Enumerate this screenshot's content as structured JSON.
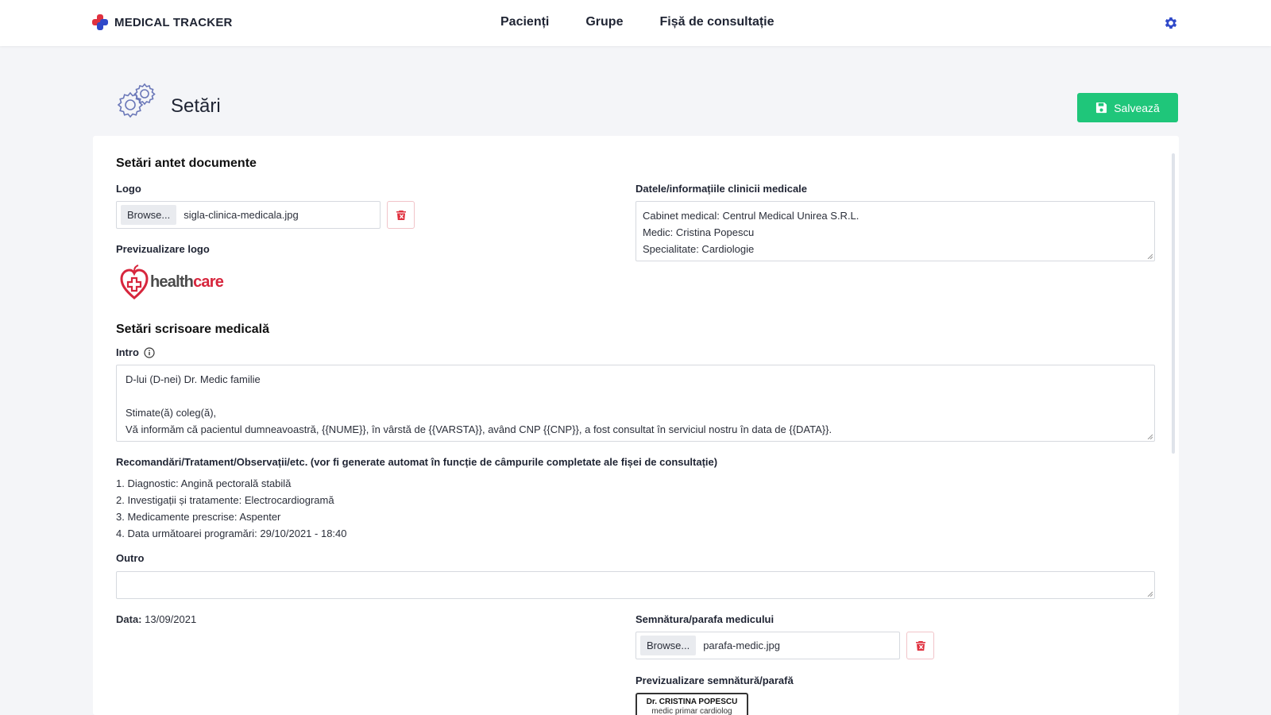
{
  "app": {
    "brand": "MEDICAL TRACKER"
  },
  "nav": {
    "items": [
      "Pacienți",
      "Grupe",
      "Fișă de consultație"
    ]
  },
  "page": {
    "title": "Setări",
    "save_label": "Salvează"
  },
  "header_settings": {
    "title": "Setări antet documente",
    "logo_label": "Logo",
    "browse_label": "Browse...",
    "logo_file": "sigla-clinica-medicala.jpg",
    "preview_label": "Previzualizare logo",
    "preview_logo": {
      "part1": "health",
      "part2": "care"
    },
    "clinic_info_label": "Datele/informațiile clinicii medicale",
    "clinic_info_lines": [
      "Cabinet medical: Centrul Medical Unirea S.R.L.",
      "Medic: Cristina Popescu",
      "Specialitate: Cardiologie"
    ]
  },
  "letter_settings": {
    "title": "Setări scrisoare medicală",
    "intro_label": "Intro",
    "intro_lines": [
      "D-lui (D-nei) Dr. Medic familie",
      "",
      "Stimate(ă) coleg(ă),",
      "Vă informăm că pacientul dumneavoastră, {{NUME}}, în vârstă de {{VARSTA}}, având CNP {{CNP}}, a fost consultat în serviciul nostru în data de {{DATA}}."
    ],
    "recommendations_label": "Recomandări/Tratament/Observații/etc. (vor fi generate automat în funcție de câmpurile completate ale fișei de consultație)",
    "recommendations": [
      "1. Diagnostic: Angină pectorală stabilă",
      "2. Investigații și tratamente: Electrocardiogramă",
      "3. Medicamente prescrise: Aspenter",
      "4. Data următoarei programări: 29/10/2021 - 18:40"
    ],
    "outro_label": "Outro",
    "outro_value": "",
    "date_label": "Data:",
    "date_value": "13/09/2021",
    "signature_label": "Semnătura/parafa medicului",
    "browse_label": "Browse...",
    "signature_file": "parafa-medic.jpg",
    "signature_preview_label": "Previzualizare semnătură/parafă",
    "stamp_line1": "Dr. CRISTINA POPESCU",
    "stamp_line2": "medic primar cardiolog"
  },
  "colors": {
    "accent": "#2f49c9",
    "success": "#1fc67a",
    "danger": "#e0313f"
  }
}
